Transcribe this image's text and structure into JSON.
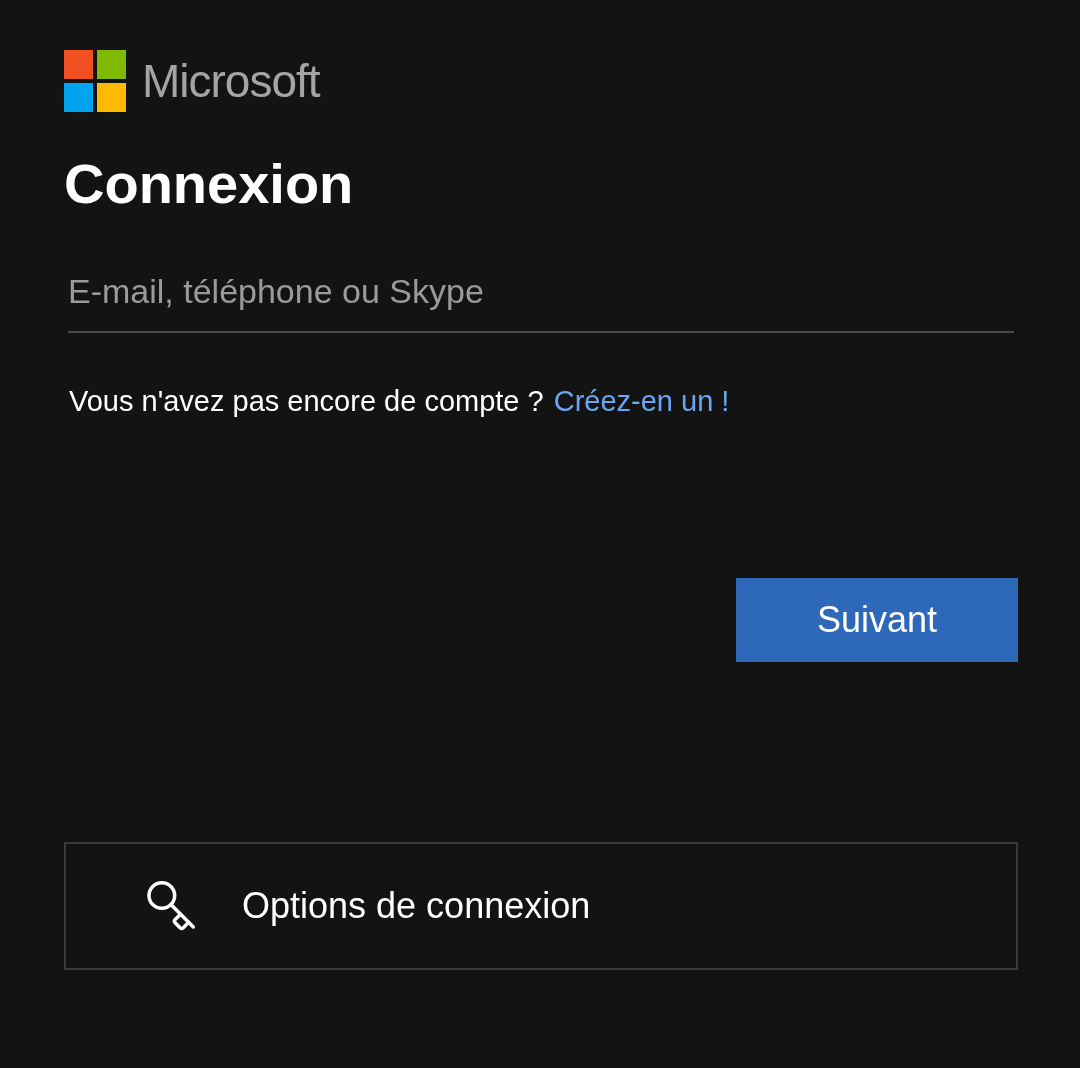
{
  "brand": {
    "name": "Microsoft"
  },
  "title": "Connexion",
  "login_field": {
    "placeholder": "E-mail, téléphone ou Skype"
  },
  "signup_prompt": {
    "text": "Vous n'avez pas encore de compte ?",
    "link": "Créez-en un !"
  },
  "next_button": {
    "label": "Suivant"
  },
  "options_button": {
    "label": "Options de connexion"
  }
}
